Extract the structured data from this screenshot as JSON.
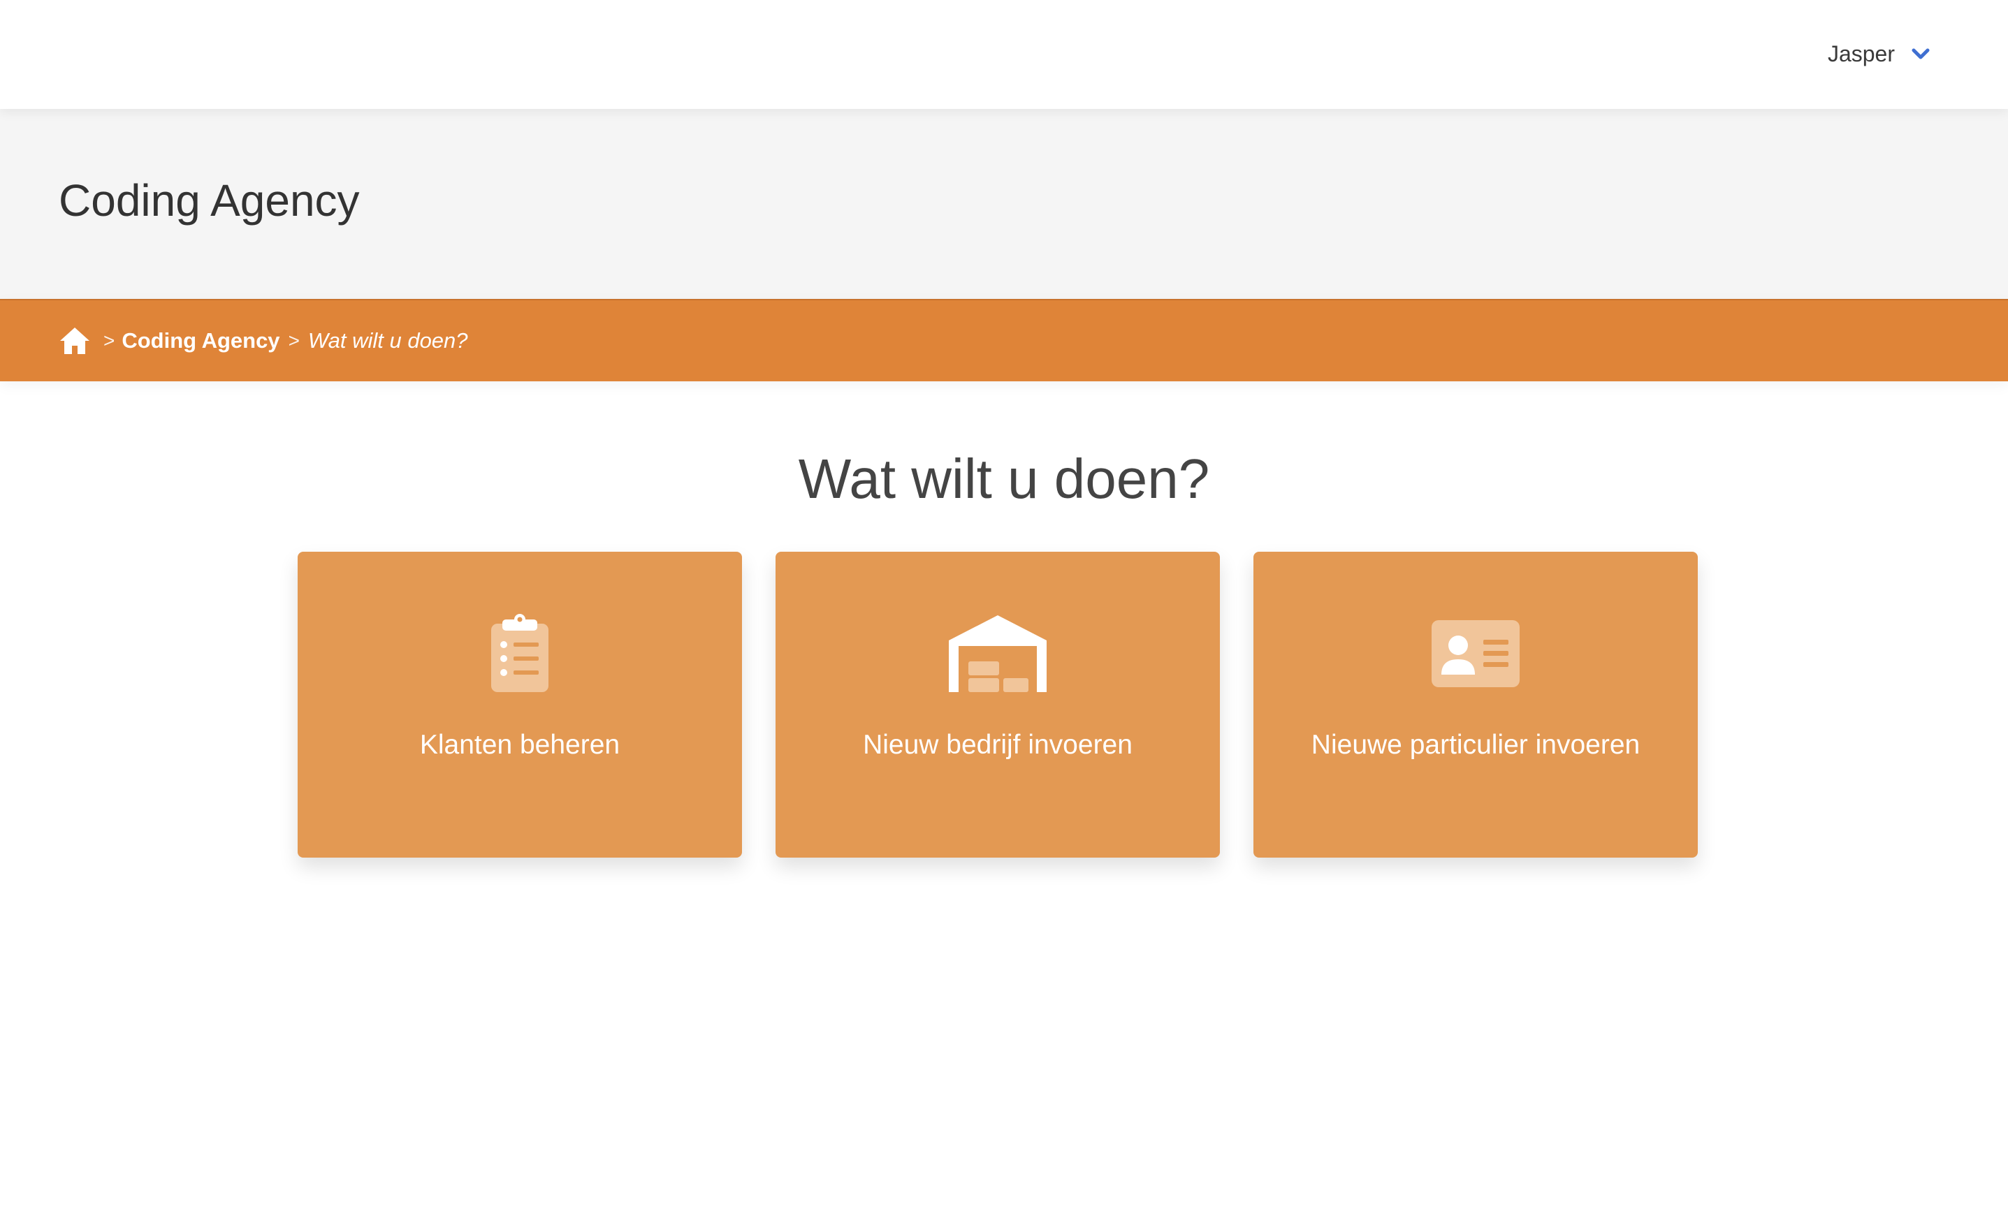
{
  "topbar": {
    "user_name": "Jasper",
    "chevron_icon": "chevron-down-icon"
  },
  "header": {
    "company_title": "Coding Agency"
  },
  "breadcrumb": {
    "home_icon": "home-icon",
    "separator": ">",
    "company_link": "Coding Agency",
    "current": "Wat wilt u doen?"
  },
  "main": {
    "title": "Wat wilt u doen?",
    "cards": [
      {
        "label": "Klanten beheren",
        "icon": "clipboard-list-icon"
      },
      {
        "label": "Nieuw bedrijf invoeren",
        "icon": "warehouse-icon"
      },
      {
        "label": "Nieuwe particulier invoeren",
        "icon": "id-card-icon"
      }
    ]
  },
  "colors": {
    "accent": "#df8438",
    "card": "#e39953",
    "chevron": "#3f6fd1",
    "header_bg": "#f5f5f5"
  }
}
